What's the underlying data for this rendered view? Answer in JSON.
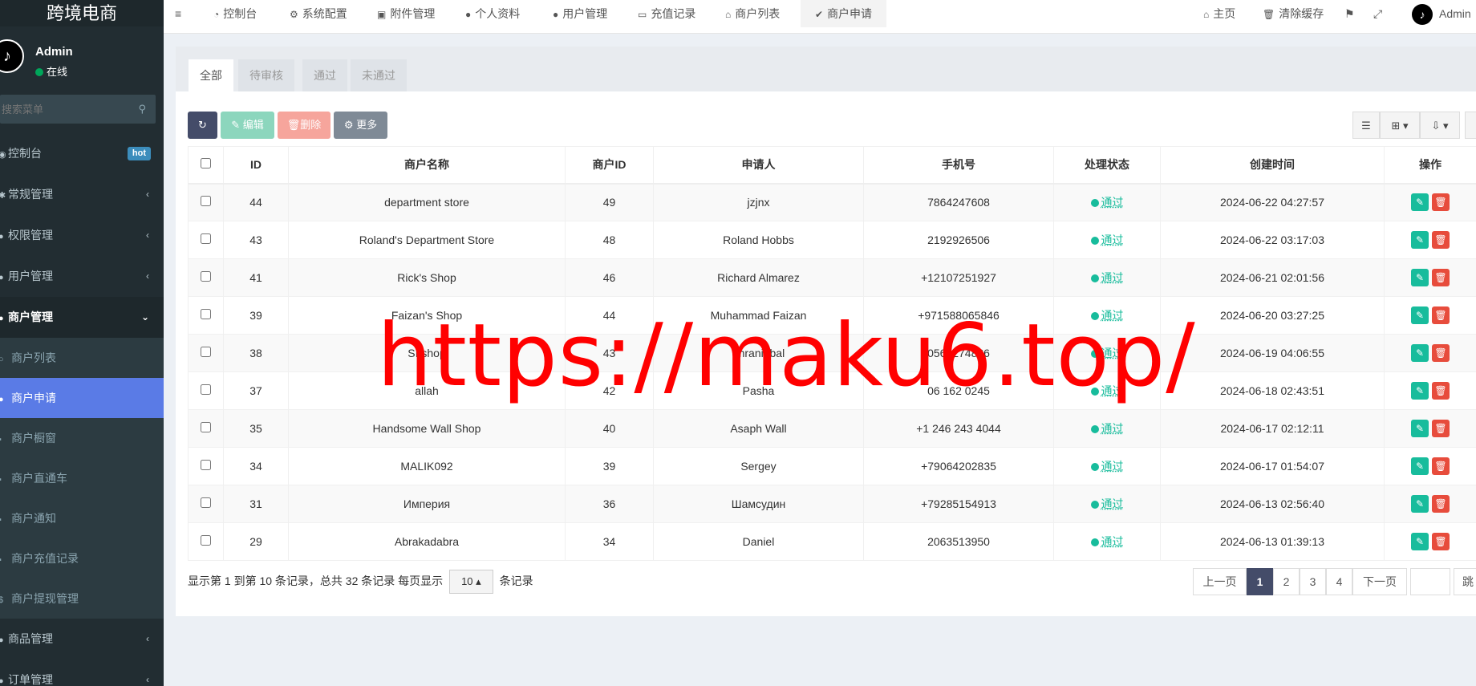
{
  "sidebar": {
    "brand": "跨境电商",
    "user": {
      "name": "Admin",
      "status": "在线"
    },
    "search_placeholder": "搜索菜单",
    "items": [
      {
        "label": "控制台",
        "badge": "hot"
      },
      {
        "label": "常规管理"
      },
      {
        "label": "权限管理"
      },
      {
        "label": "用户管理"
      },
      {
        "label": "商户管理"
      }
    ],
    "sub_items": [
      {
        "label": "商户列表"
      },
      {
        "label": "商户申请"
      },
      {
        "label": "商户橱窗"
      },
      {
        "label": "商户直通车"
      },
      {
        "label": "商户通知"
      },
      {
        "label": "商户充值记录"
      },
      {
        "label": "商户提现管理"
      }
    ],
    "lower_items": [
      {
        "label": "商品管理"
      },
      {
        "label": "订单管理"
      }
    ]
  },
  "topbar": {
    "tabs": [
      {
        "label": "控制台"
      },
      {
        "label": "系统配置"
      },
      {
        "label": "附件管理"
      },
      {
        "label": "个人资料"
      },
      {
        "label": "用户管理"
      },
      {
        "label": "充值记录"
      },
      {
        "label": "商户列表"
      },
      {
        "label": "商户申请"
      }
    ],
    "home": "主页",
    "clear_cache": "清除缓存",
    "user": "Admin"
  },
  "panel": {
    "tabs": [
      "全部",
      "待审核",
      "通过",
      "未通过"
    ],
    "toolbar": {
      "edit": "编辑",
      "delete": "删除",
      "more": "更多"
    }
  },
  "table": {
    "headers": [
      "ID",
      "商户名称",
      "商户ID",
      "申请人",
      "手机号",
      "处理状态",
      "创建时间",
      "操作"
    ],
    "rows": [
      {
        "id": "44",
        "name": "department store",
        "mid": "49",
        "applicant": "jzjnx",
        "phone": "7864247608",
        "status": "通过",
        "time": "2024-06-22 04:27:57"
      },
      {
        "id": "43",
        "name": "Roland's Department Store",
        "mid": "48",
        "applicant": "Roland Hobbs",
        "phone": "2192926506",
        "status": "通过",
        "time": "2024-06-22 03:17:03"
      },
      {
        "id": "41",
        "name": "Rick's Shop",
        "mid": "46",
        "applicant": "Richard Almarez",
        "phone": "+12107251927",
        "status": "通过",
        "time": "2024-06-21 02:01:56"
      },
      {
        "id": "39",
        "name": "Faizan's Shop",
        "mid": "44",
        "applicant": "Muhammad Faizan",
        "phone": "+971588065846",
        "status": "通过",
        "time": "2024-06-20 03:27:25"
      },
      {
        "id": "38",
        "name": "SI shop",
        "mid": "43",
        "applicant": "Imraniqbal",
        "phone": "0561274826",
        "status": "通过",
        "time": "2024-06-19 04:06:55"
      },
      {
        "id": "37",
        "name": "allah",
        "mid": "42",
        "applicant": "Pasha",
        "phone": "06 162 0245",
        "status": "通过",
        "time": "2024-06-18 02:43:51"
      },
      {
        "id": "35",
        "name": "Handsome Wall Shop",
        "mid": "40",
        "applicant": "Asaph Wall",
        "phone": "+1 246 243 4044",
        "status": "通过",
        "time": "2024-06-17 02:12:11"
      },
      {
        "id": "34",
        "name": "MALIK092",
        "mid": "39",
        "applicant": "Sergey",
        "phone": "+79064202835",
        "status": "通过",
        "time": "2024-06-17 01:54:07"
      },
      {
        "id": "31",
        "name": "Империя",
        "mid": "36",
        "applicant": "Шамсудин",
        "phone": "+79285154913",
        "status": "通过",
        "time": "2024-06-13 02:56:40"
      },
      {
        "id": "29",
        "name": "Abrakadabra",
        "mid": "34",
        "applicant": "Daniel",
        "phone": "2063513950",
        "status": "通过",
        "time": "2024-06-13 01:39:13"
      }
    ]
  },
  "pagination": {
    "info_prefix": "显示第 1 到第 10 条记录，总共 32 条记录 每页显示",
    "page_size": "10",
    "info_suffix": "条记录",
    "prev": "上一页",
    "pages": [
      "1",
      "2",
      "3",
      "4"
    ],
    "next": "下一页",
    "jump": "跳"
  },
  "watermark": "https://maku6.top/"
}
